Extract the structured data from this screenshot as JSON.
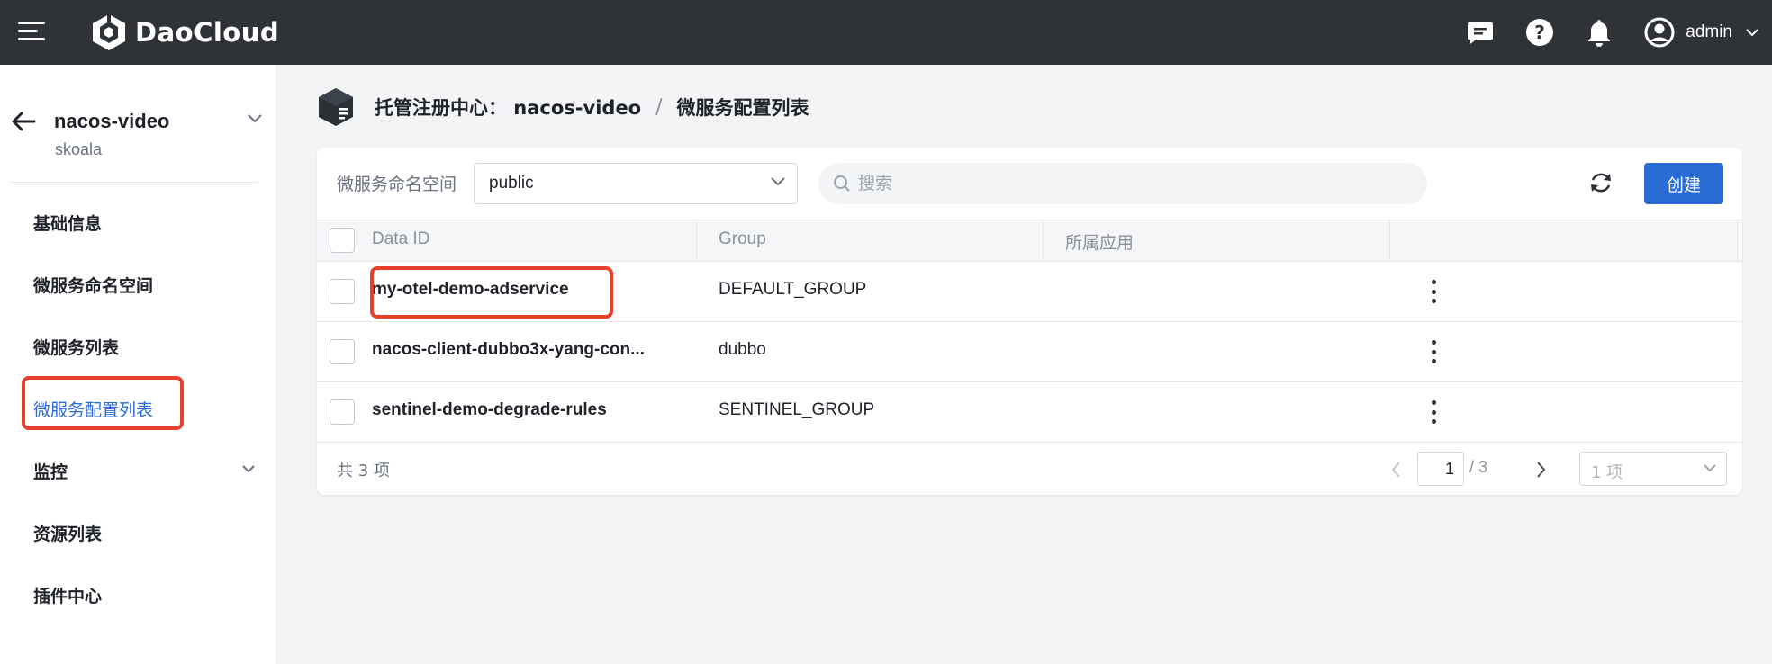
{
  "topbar": {
    "brand": "DaoCloud",
    "user": "admin",
    "icons": [
      "menu-icon",
      "message-icon",
      "help-icon",
      "bell-icon",
      "user-avatar-icon",
      "chevron-down-icon"
    ]
  },
  "sidebar": {
    "title": "nacos-video",
    "subtitle": "skoala",
    "items": [
      {
        "label": "基础信息"
      },
      {
        "label": "微服务命名空间"
      },
      {
        "label": "微服务列表"
      },
      {
        "label": "微服务配置列表",
        "active": true
      },
      {
        "label": "监控",
        "expandable": true
      },
      {
        "label": "资源列表"
      },
      {
        "label": "插件中心"
      }
    ]
  },
  "breadcrumb": {
    "parent": "托管注册中心： nacos-video",
    "separator": "/",
    "current": "微服务配置列表"
  },
  "toolbar": {
    "namespace_label": "微服务命名空间",
    "namespace_value": "public",
    "search_placeholder": "搜索",
    "create_label": "创建"
  },
  "table": {
    "columns": [
      "Data ID",
      "Group",
      "所属应用"
    ],
    "rows": [
      {
        "data_id": "my-otel-demo-adservice",
        "group": "DEFAULT_GROUP",
        "app": ""
      },
      {
        "data_id": "nacos-client-dubbo3x-yang-con...",
        "group": "dubbo",
        "app": ""
      },
      {
        "data_id": "sentinel-demo-degrade-rules",
        "group": "SENTINEL_GROUP",
        "app": ""
      }
    ]
  },
  "footer": {
    "total": "共 3 项",
    "current_page": "1",
    "page_total": "/ 3",
    "page_size": "1 项"
  },
  "colors": {
    "accent": "#2b6bd6",
    "highlight": "#e8402b",
    "topbar": "#2f3338"
  }
}
